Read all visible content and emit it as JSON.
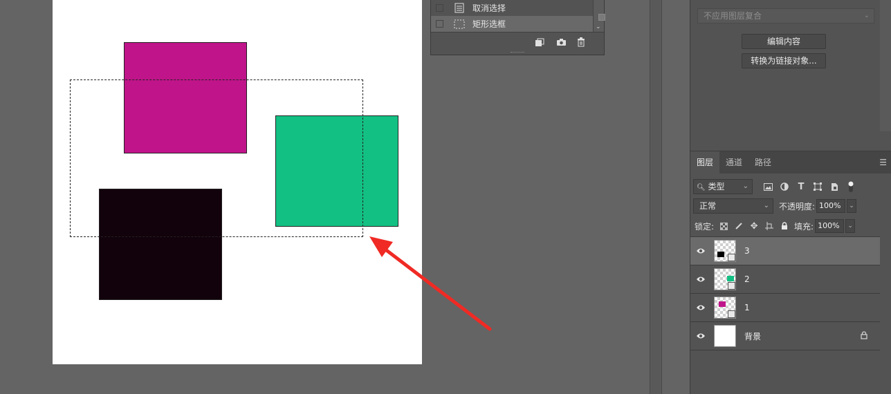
{
  "history": {
    "items": [
      {
        "label": "取消选择",
        "selected": false
      },
      {
        "label": "矩形选框",
        "selected": true
      }
    ]
  },
  "canvas": {
    "shapes": [
      {
        "name": "magenta-square",
        "color": "#c0148a"
      },
      {
        "name": "green-square",
        "color": "#13c083"
      },
      {
        "name": "black-square",
        "color": "#12020b"
      }
    ],
    "annotation_color": "#f02a24"
  },
  "properties": {
    "comp_placeholder": "不应用图层复合",
    "edit_contents": "编辑内容",
    "convert_linked": "转换为链接对象..."
  },
  "layers_panel": {
    "tabs": [
      "图层",
      "通道",
      "路径"
    ],
    "filter_kind": "类型",
    "blend_mode": "正常",
    "opacity_label": "不透明度:",
    "opacity": "100%",
    "lock_label": "锁定:",
    "fill_label": "填充:",
    "fill": "100%",
    "layers": [
      {
        "name": "3",
        "selected": true,
        "swatch": "#000000",
        "plain": false,
        "locked": false
      },
      {
        "name": "2",
        "selected": false,
        "swatch": "#13c083",
        "plain": false,
        "locked": false
      },
      {
        "name": "1",
        "selected": false,
        "swatch": "#c0148a",
        "plain": false,
        "locked": false
      },
      {
        "name": "背景",
        "selected": false,
        "swatch": "",
        "plain": true,
        "locked": true
      }
    ]
  }
}
